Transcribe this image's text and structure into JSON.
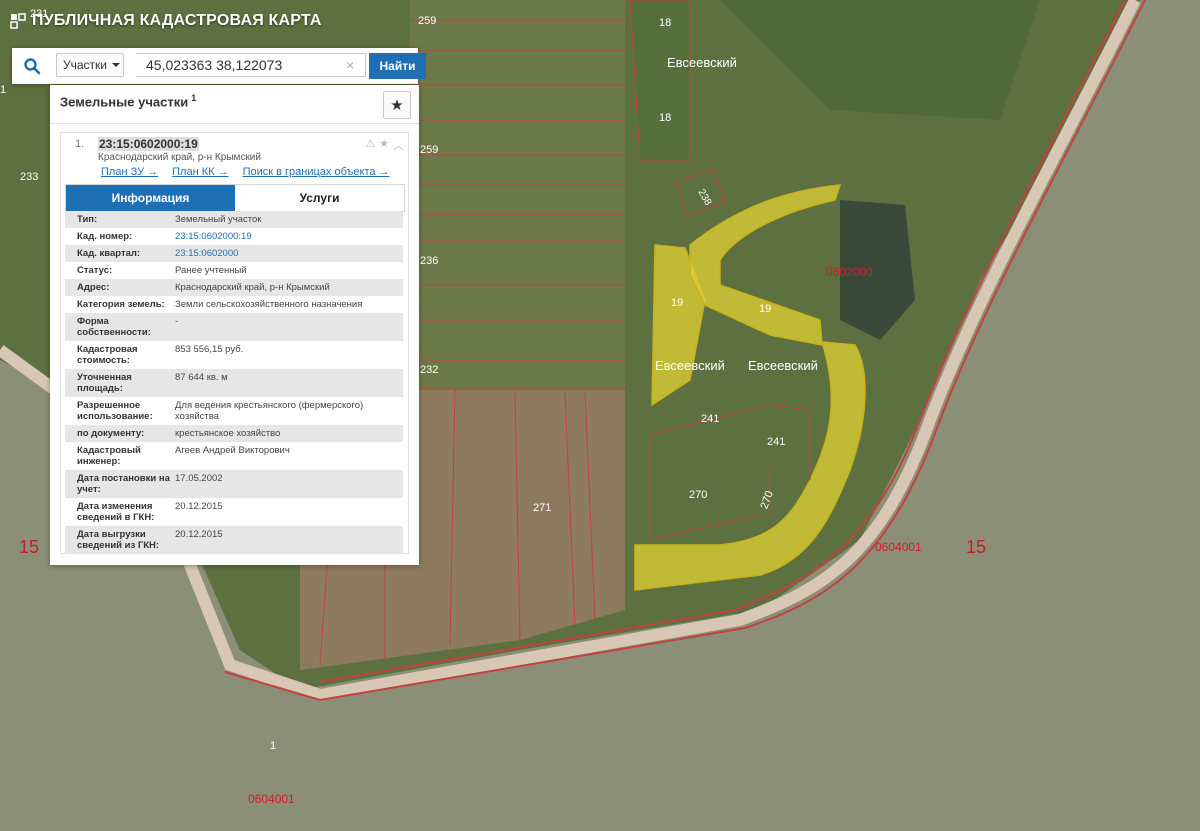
{
  "app": {
    "title": "ПУБЛИЧНАЯ КАДАСТРОВАЯ КАРТА"
  },
  "search": {
    "type_label": "Участки",
    "query": "45,023363 38,122073",
    "find_label": "Найти",
    "clear_label": "×"
  },
  "panel": {
    "heading": "Земельные участки",
    "count": "1",
    "record": {
      "index": "1.",
      "cad_number": "23:15:0602000:19",
      "address": "Краснодарский край, р-н Крымский",
      "links": [
        "План ЗУ →",
        "План КК →",
        "Поиск в границах объекта →"
      ]
    },
    "tabs": [
      "Информация",
      "Услуги"
    ],
    "rows": [
      {
        "k": "Тип:",
        "v": "Земельный участок"
      },
      {
        "k": "Кад. номер:",
        "v": "23:15:0602000:19",
        "link": true
      },
      {
        "k": "Кад. квартал:",
        "v": "23:15:0602000",
        "link": true
      },
      {
        "k": "Статус:",
        "v": "Ранее учтенный"
      },
      {
        "k": "Адрес:",
        "v": "Краснодарский край, р-н Крымский"
      },
      {
        "k": "Категория земель:",
        "v": "Земли сельскохозяйственного назначения"
      },
      {
        "k": "Форма собственности:",
        "v": "-"
      },
      {
        "k": "Кадастровая стоимость:",
        "v": "853 556,15 руб."
      },
      {
        "k": "Уточненная площадь:",
        "v": "87 644 кв. м"
      },
      {
        "k": "Разрешенное использование:",
        "v": "Для ведения крестьянского (фермерского) хозяйства"
      },
      {
        "k": "по документу:",
        "v": "крестьянское хозяйство"
      },
      {
        "k": "Кадастровый инженер:",
        "v": "Агеев Андрей Викторович"
      },
      {
        "k": "Дата постановки на учет:",
        "v": "17.05.2002"
      },
      {
        "k": "Дата изменения сведений в ГКН:",
        "v": "20.12.2015"
      },
      {
        "k": "Дата выгрузки сведений из ГКН:",
        "v": "20.12.2015"
      }
    ]
  },
  "map_labels": {
    "l231": "231",
    "l259a": "259",
    "l259b": "259",
    "l233": "233",
    "l236": "236",
    "l232": "232",
    "l18a": "18",
    "l18b": "18",
    "l238": "238",
    "evseevsky_top": "Евсеевский",
    "evseevsky_left": "Евсеевский",
    "evseevsky_right": "Евсеевский",
    "l19a": "19",
    "l19b": "19",
    "block_0602000": "0602000",
    "l241a": "241",
    "l241b": "241",
    "l270a": "270",
    "l270b": "270",
    "l271": "271",
    "block_0604001a": "0604001",
    "block_0604001b": "0604001",
    "l15a": "15",
    "l15b": "15",
    "l1": "1",
    "edge1": "1"
  },
  "colors": {
    "accent": "#1f6fb5",
    "parcel_border": "#d0202a",
    "highlight": "#e0d230"
  }
}
